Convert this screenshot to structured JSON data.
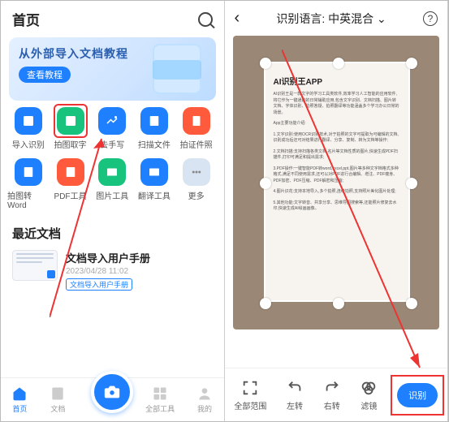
{
  "left": {
    "header": {
      "title": "首页"
    },
    "banner": {
      "title": "从外部导入文档教程",
      "button": "查看教程"
    },
    "tools": [
      {
        "label": "导入识别",
        "bg": "#1e80ff",
        "hl": false
      },
      {
        "label": "拍图取字",
        "bg": "#18c37d",
        "hl": true
      },
      {
        "label": "去手写",
        "bg": "#1e80ff",
        "hl": false
      },
      {
        "label": "扫描文件",
        "bg": "#1e80ff",
        "hl": false
      },
      {
        "label": "拍证件照",
        "bg": "#ff5a3c",
        "hl": false
      },
      {
        "label": "拍图转Word",
        "bg": "#1e80ff",
        "hl": false
      },
      {
        "label": "PDF工具",
        "bg": "#ff5a3c",
        "hl": false
      },
      {
        "label": "图片工具",
        "bg": "#18c37d",
        "hl": false
      },
      {
        "label": "翻译工具",
        "bg": "#1e80ff",
        "hl": false
      },
      {
        "label": "更多",
        "bg": "#d9e4f2",
        "hl": false
      }
    ],
    "recent": {
      "title": "最近文档",
      "doc": {
        "title": "文档导入用户手册",
        "date": "2023/04/28 11:02",
        "tag": "文档导入用户手册"
      }
    },
    "nav": [
      {
        "label": "首页",
        "active": true
      },
      {
        "label": "文档",
        "active": false
      },
      {
        "label": "全部工具",
        "active": false
      },
      {
        "label": "我的",
        "active": false
      }
    ]
  },
  "right": {
    "header": {
      "label": "识别语言:",
      "value": "中英混合"
    },
    "page": {
      "title": "AI识别王APP",
      "paragraphs": [
        "AI识别王是一款文字的学习工具类软件,效率学习人工智能的应用软件,将它作为一键通勤的日常辅助应用,包含文字识别、文档扫描、图片转文档、字体识别、拍照答疑、拍照翻译等功能涵盖多个学习办公日常的场景。",
        "App主要功能介绍:",
        "1.文字识别:使用OCR识别技术,对于拍照的文字可提取为可编辑的文档,识别成功后还可对结果进行翻译、分享、复制、转为文档等操作;",
        "2.文档扫描:支持扫描各类文档,名片等文档性质的图片,快速生成PDF扫描件,打印可满足和提出需求;",
        "3.PDF操作:一键智能PDF转word,excel,ppt,图片等多种文字档格式多种格式,满足不同使用需求,还可以对PDF进行合编辑、增注、PDF瘦身、PDF加密、PDF压缩、PDF解密和压缩;",
        "4.图片识花:支持本地导入,多个拍照,连续拍照,支持照片美化图片处理;",
        "5.其他功能:文字转音、共享分享、思维导图搜索等,还能照片修复去水印,快速生成AI绘画画像。"
      ]
    },
    "toolbar": [
      {
        "label": "全部范围"
      },
      {
        "label": "左转"
      },
      {
        "label": "右转"
      },
      {
        "label": "滤镜"
      }
    ],
    "recognize": "识别"
  }
}
